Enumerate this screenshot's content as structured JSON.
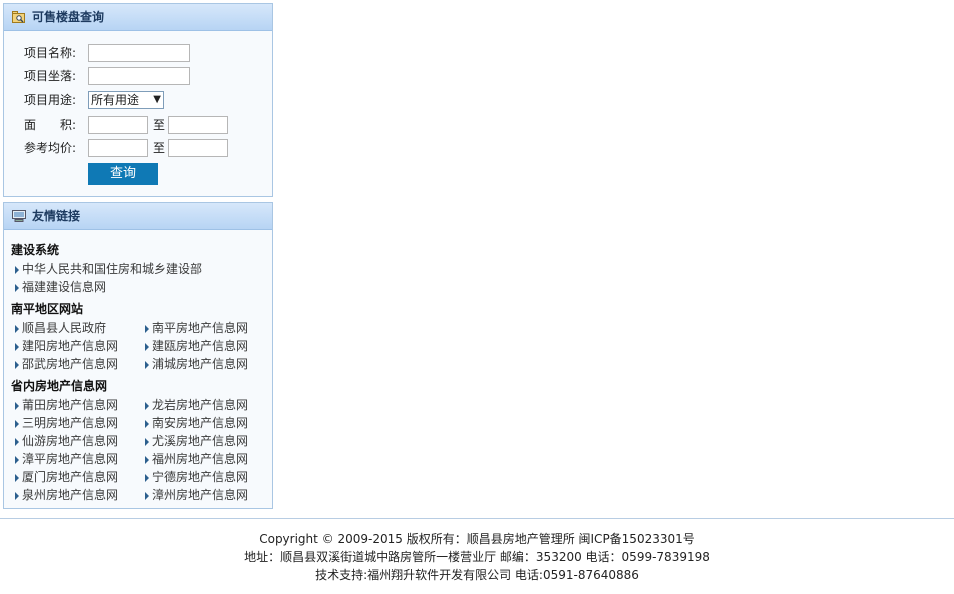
{
  "search": {
    "title": "可售楼盘查询",
    "icon": "search-folder-icon",
    "fields": {
      "project_name_label": "项目名称:",
      "project_location_label": "项目坐落:",
      "project_use_label": "项目用途:",
      "area_label": "面　　积:",
      "price_label": "参考均价:",
      "to_label": "至"
    },
    "project_use_selected": "所有用途",
    "submit_label": "查询"
  },
  "links": {
    "title": "友情链接",
    "icon": "links-icon",
    "group1_title": "建设系统",
    "group1": [
      "中华人民共和国住房和城乡建设部",
      "福建建设信息网"
    ],
    "group2_title": "南平地区网站",
    "group2": [
      "顺昌县人民政府",
      "南平房地产信息网",
      "建阳房地产信息网",
      "建瓯房地产信息网",
      "邵武房地产信息网",
      "浦城房地产信息网"
    ],
    "group3_title": "省内房地产信息网",
    "group3": [
      "莆田房地产信息网",
      "龙岩房地产信息网",
      "三明房地产信息网",
      "南安房地产信息网",
      "仙游房地产信息网",
      "尤溪房地产信息网",
      "漳平房地产信息网",
      "福州房地产信息网",
      "厦门房地产信息网",
      "宁德房地产信息网",
      "泉州房地产信息网",
      "漳州房地产信息网"
    ]
  },
  "footer": {
    "line1": "Copyright © 2009-2015 版权所有：顺昌县房地产管理所 闽ICP备15023301号",
    "line2": "地址：顺昌县双溪街道城中路房管所一楼营业厅 邮编：353200 电话：0599-7839198",
    "line3": "技术支持:福州翔升软件开发有限公司 电话:0591-87640886"
  },
  "colors": {
    "header_gradient_top": "#d6e7fa",
    "header_gradient_bottom": "#b7d4f4",
    "button": "#0f79b5",
    "border": "#a9c6e3"
  }
}
